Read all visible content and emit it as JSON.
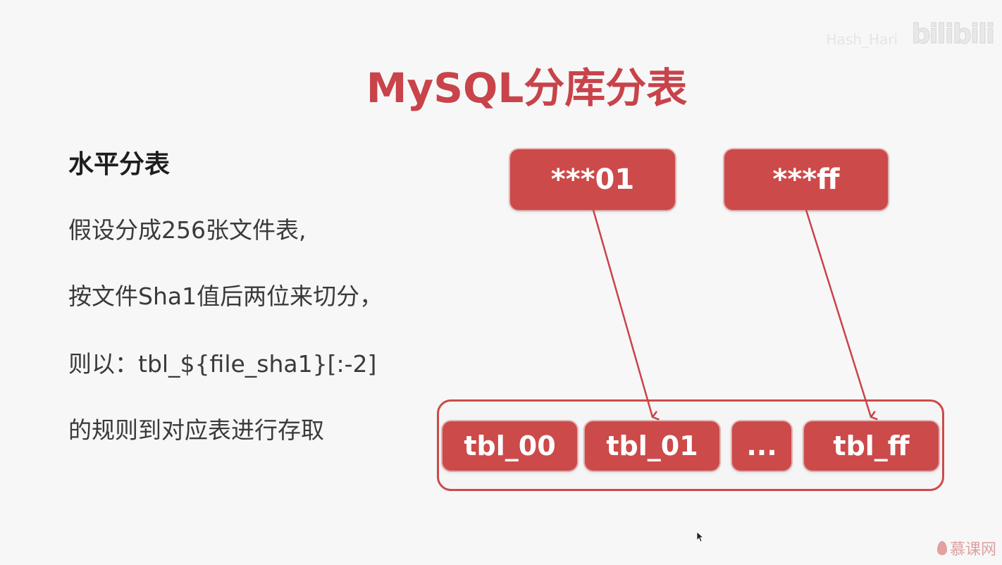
{
  "watermark": {
    "top_small": "Hash_Hari",
    "top_logo": "bilibili",
    "bottom": "慕课网"
  },
  "slide": {
    "title": "MySQL分库分表",
    "section_heading": "水平分表",
    "lines": [
      "假设分成256张文件表,",
      "按文件Sha1值后两位来切分，",
      "则以：tbl_${file_sha1}[:-2]",
      "的规则到对应表进行存取"
    ]
  },
  "diagram": {
    "sources": [
      "***01",
      "***ff"
    ],
    "tables": [
      "tbl_00",
      "tbl_01",
      "...",
      "tbl_ff"
    ],
    "mappings": [
      {
        "from": "***01",
        "to": "tbl_01"
      },
      {
        "from": "***ff",
        "to": "tbl_ff"
      }
    ]
  },
  "colors": {
    "accent": "#c8434a",
    "box_fill": "#cc4a4a",
    "text": "#3a3a3a",
    "background": "#f7f7f7"
  }
}
